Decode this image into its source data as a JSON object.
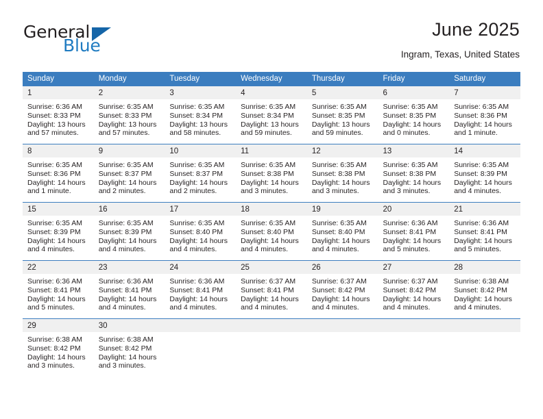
{
  "logo": {
    "word_top": "General",
    "word_bottom": "Blue",
    "accent_color": "#1f7bc1",
    "triangle_color": "#1565a8"
  },
  "header": {
    "title": "June 2025",
    "location": "Ingram, Texas, United States"
  },
  "theme": {
    "header_bar": "#3b7dbf",
    "daynum_band": "#f0f0f0",
    "text": "#231f20"
  },
  "weekday_headers": [
    "Sunday",
    "Monday",
    "Tuesday",
    "Wednesday",
    "Thursday",
    "Friday",
    "Saturday"
  ],
  "weeks": [
    [
      {
        "day": "1",
        "sunrise": "Sunrise: 6:36 AM",
        "sunset": "Sunset: 8:33 PM",
        "daylight_1": "Daylight: 13 hours",
        "daylight_2": "and 57 minutes."
      },
      {
        "day": "2",
        "sunrise": "Sunrise: 6:35 AM",
        "sunset": "Sunset: 8:33 PM",
        "daylight_1": "Daylight: 13 hours",
        "daylight_2": "and 57 minutes."
      },
      {
        "day": "3",
        "sunrise": "Sunrise: 6:35 AM",
        "sunset": "Sunset: 8:34 PM",
        "daylight_1": "Daylight: 13 hours",
        "daylight_2": "and 58 minutes."
      },
      {
        "day": "4",
        "sunrise": "Sunrise: 6:35 AM",
        "sunset": "Sunset: 8:34 PM",
        "daylight_1": "Daylight: 13 hours",
        "daylight_2": "and 59 minutes."
      },
      {
        "day": "5",
        "sunrise": "Sunrise: 6:35 AM",
        "sunset": "Sunset: 8:35 PM",
        "daylight_1": "Daylight: 13 hours",
        "daylight_2": "and 59 minutes."
      },
      {
        "day": "6",
        "sunrise": "Sunrise: 6:35 AM",
        "sunset": "Sunset: 8:35 PM",
        "daylight_1": "Daylight: 14 hours",
        "daylight_2": "and 0 minutes."
      },
      {
        "day": "7",
        "sunrise": "Sunrise: 6:35 AM",
        "sunset": "Sunset: 8:36 PM",
        "daylight_1": "Daylight: 14 hours",
        "daylight_2": "and 1 minute."
      }
    ],
    [
      {
        "day": "8",
        "sunrise": "Sunrise: 6:35 AM",
        "sunset": "Sunset: 8:36 PM",
        "daylight_1": "Daylight: 14 hours",
        "daylight_2": "and 1 minute."
      },
      {
        "day": "9",
        "sunrise": "Sunrise: 6:35 AM",
        "sunset": "Sunset: 8:37 PM",
        "daylight_1": "Daylight: 14 hours",
        "daylight_2": "and 2 minutes."
      },
      {
        "day": "10",
        "sunrise": "Sunrise: 6:35 AM",
        "sunset": "Sunset: 8:37 PM",
        "daylight_1": "Daylight: 14 hours",
        "daylight_2": "and 2 minutes."
      },
      {
        "day": "11",
        "sunrise": "Sunrise: 6:35 AM",
        "sunset": "Sunset: 8:38 PM",
        "daylight_1": "Daylight: 14 hours",
        "daylight_2": "and 3 minutes."
      },
      {
        "day": "12",
        "sunrise": "Sunrise: 6:35 AM",
        "sunset": "Sunset: 8:38 PM",
        "daylight_1": "Daylight: 14 hours",
        "daylight_2": "and 3 minutes."
      },
      {
        "day": "13",
        "sunrise": "Sunrise: 6:35 AM",
        "sunset": "Sunset: 8:38 PM",
        "daylight_1": "Daylight: 14 hours",
        "daylight_2": "and 3 minutes."
      },
      {
        "day": "14",
        "sunrise": "Sunrise: 6:35 AM",
        "sunset": "Sunset: 8:39 PM",
        "daylight_1": "Daylight: 14 hours",
        "daylight_2": "and 4 minutes."
      }
    ],
    [
      {
        "day": "15",
        "sunrise": "Sunrise: 6:35 AM",
        "sunset": "Sunset: 8:39 PM",
        "daylight_1": "Daylight: 14 hours",
        "daylight_2": "and 4 minutes."
      },
      {
        "day": "16",
        "sunrise": "Sunrise: 6:35 AM",
        "sunset": "Sunset: 8:39 PM",
        "daylight_1": "Daylight: 14 hours",
        "daylight_2": "and 4 minutes."
      },
      {
        "day": "17",
        "sunrise": "Sunrise: 6:35 AM",
        "sunset": "Sunset: 8:40 PM",
        "daylight_1": "Daylight: 14 hours",
        "daylight_2": "and 4 minutes."
      },
      {
        "day": "18",
        "sunrise": "Sunrise: 6:35 AM",
        "sunset": "Sunset: 8:40 PM",
        "daylight_1": "Daylight: 14 hours",
        "daylight_2": "and 4 minutes."
      },
      {
        "day": "19",
        "sunrise": "Sunrise: 6:35 AM",
        "sunset": "Sunset: 8:40 PM",
        "daylight_1": "Daylight: 14 hours",
        "daylight_2": "and 4 minutes."
      },
      {
        "day": "20",
        "sunrise": "Sunrise: 6:36 AM",
        "sunset": "Sunset: 8:41 PM",
        "daylight_1": "Daylight: 14 hours",
        "daylight_2": "and 5 minutes."
      },
      {
        "day": "21",
        "sunrise": "Sunrise: 6:36 AM",
        "sunset": "Sunset: 8:41 PM",
        "daylight_1": "Daylight: 14 hours",
        "daylight_2": "and 5 minutes."
      }
    ],
    [
      {
        "day": "22",
        "sunrise": "Sunrise: 6:36 AM",
        "sunset": "Sunset: 8:41 PM",
        "daylight_1": "Daylight: 14 hours",
        "daylight_2": "and 5 minutes."
      },
      {
        "day": "23",
        "sunrise": "Sunrise: 6:36 AM",
        "sunset": "Sunset: 8:41 PM",
        "daylight_1": "Daylight: 14 hours",
        "daylight_2": "and 4 minutes."
      },
      {
        "day": "24",
        "sunrise": "Sunrise: 6:36 AM",
        "sunset": "Sunset: 8:41 PM",
        "daylight_1": "Daylight: 14 hours",
        "daylight_2": "and 4 minutes."
      },
      {
        "day": "25",
        "sunrise": "Sunrise: 6:37 AM",
        "sunset": "Sunset: 8:41 PM",
        "daylight_1": "Daylight: 14 hours",
        "daylight_2": "and 4 minutes."
      },
      {
        "day": "26",
        "sunrise": "Sunrise: 6:37 AM",
        "sunset": "Sunset: 8:42 PM",
        "daylight_1": "Daylight: 14 hours",
        "daylight_2": "and 4 minutes."
      },
      {
        "day": "27",
        "sunrise": "Sunrise: 6:37 AM",
        "sunset": "Sunset: 8:42 PM",
        "daylight_1": "Daylight: 14 hours",
        "daylight_2": "and 4 minutes."
      },
      {
        "day": "28",
        "sunrise": "Sunrise: 6:38 AM",
        "sunset": "Sunset: 8:42 PM",
        "daylight_1": "Daylight: 14 hours",
        "daylight_2": "and 4 minutes."
      }
    ],
    [
      {
        "day": "29",
        "sunrise": "Sunrise: 6:38 AM",
        "sunset": "Sunset: 8:42 PM",
        "daylight_1": "Daylight: 14 hours",
        "daylight_2": "and 3 minutes."
      },
      {
        "day": "30",
        "sunrise": "Sunrise: 6:38 AM",
        "sunset": "Sunset: 8:42 PM",
        "daylight_1": "Daylight: 14 hours",
        "daylight_2": "and 3 minutes."
      },
      {
        "day": "",
        "sunrise": "",
        "sunset": "",
        "daylight_1": "",
        "daylight_2": ""
      },
      {
        "day": "",
        "sunrise": "",
        "sunset": "",
        "daylight_1": "",
        "daylight_2": ""
      },
      {
        "day": "",
        "sunrise": "",
        "sunset": "",
        "daylight_1": "",
        "daylight_2": ""
      },
      {
        "day": "",
        "sunrise": "",
        "sunset": "",
        "daylight_1": "",
        "daylight_2": ""
      },
      {
        "day": "",
        "sunrise": "",
        "sunset": "",
        "daylight_1": "",
        "daylight_2": ""
      }
    ]
  ]
}
